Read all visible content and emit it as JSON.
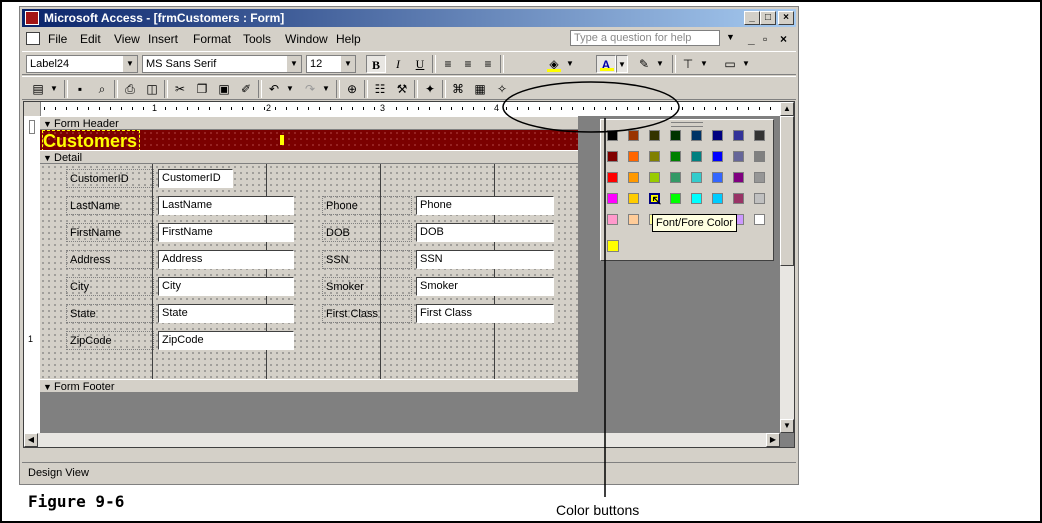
{
  "window_title": "Microsoft Access - [frmCustomers : Form]",
  "menu": [
    "File",
    "Edit",
    "View",
    "Insert",
    "Format",
    "Tools",
    "Window",
    "Help"
  ],
  "help_placeholder": "Type a question for help",
  "formatting": {
    "object": "Label24",
    "font": "MS Sans Serif",
    "size": "12",
    "bold": "B",
    "italic": "I",
    "underline": "U"
  },
  "ruler_numbers": [
    "1",
    "2",
    "3",
    "4"
  ],
  "sections": {
    "header": "Form Header",
    "detail": "Detail",
    "footer": "Form Footer"
  },
  "header_label": "Customers",
  "fields_left": [
    {
      "label": "CustomerID",
      "field": "CustomerID"
    },
    {
      "label": "LastName",
      "field": "LastName"
    },
    {
      "label": "FirstName",
      "field": "FirstName"
    },
    {
      "label": "Address",
      "field": "Address"
    },
    {
      "label": "City",
      "field": "City"
    },
    {
      "label": "State",
      "field": "State"
    },
    {
      "label": "ZipCode",
      "field": "ZipCode"
    }
  ],
  "fields_right": [
    {
      "label": "Phone",
      "field": "Phone"
    },
    {
      "label": "DOB",
      "field": "DOB"
    },
    {
      "label": "SSN",
      "field": "SSN"
    },
    {
      "label": "Smoker",
      "field": "Smoker"
    },
    {
      "label": "First Class",
      "field": "First Class"
    }
  ],
  "status_text": "Design View",
  "tooltip": "Font/Fore Color",
  "palette_colors": [
    "#000000",
    "#993300",
    "#333300",
    "#003300",
    "#003366",
    "#000080",
    "#333399",
    "#333333",
    "#800000",
    "#ff6600",
    "#808000",
    "#008000",
    "#008080",
    "#0000ff",
    "#666699",
    "#808080",
    "#ff0000",
    "#ff9900",
    "#99cc00",
    "#339966",
    "#33cccc",
    "#3366ff",
    "#800080",
    "#969696",
    "#ff00ff",
    "#ffcc00",
    "#ffff00",
    "#00ff00",
    "#00ffff",
    "#00ccff",
    "#993366",
    "#c0c0c0",
    "#ff99cc",
    "#ffcc99",
    "#ffff99",
    "#ccffcc",
    "#ccffff",
    "#99ccff",
    "#cc99ff",
    "#ffffff"
  ],
  "recent_color": "#ffff00",
  "figure_caption": "Figure 9-6",
  "callout_label": "Color buttons"
}
